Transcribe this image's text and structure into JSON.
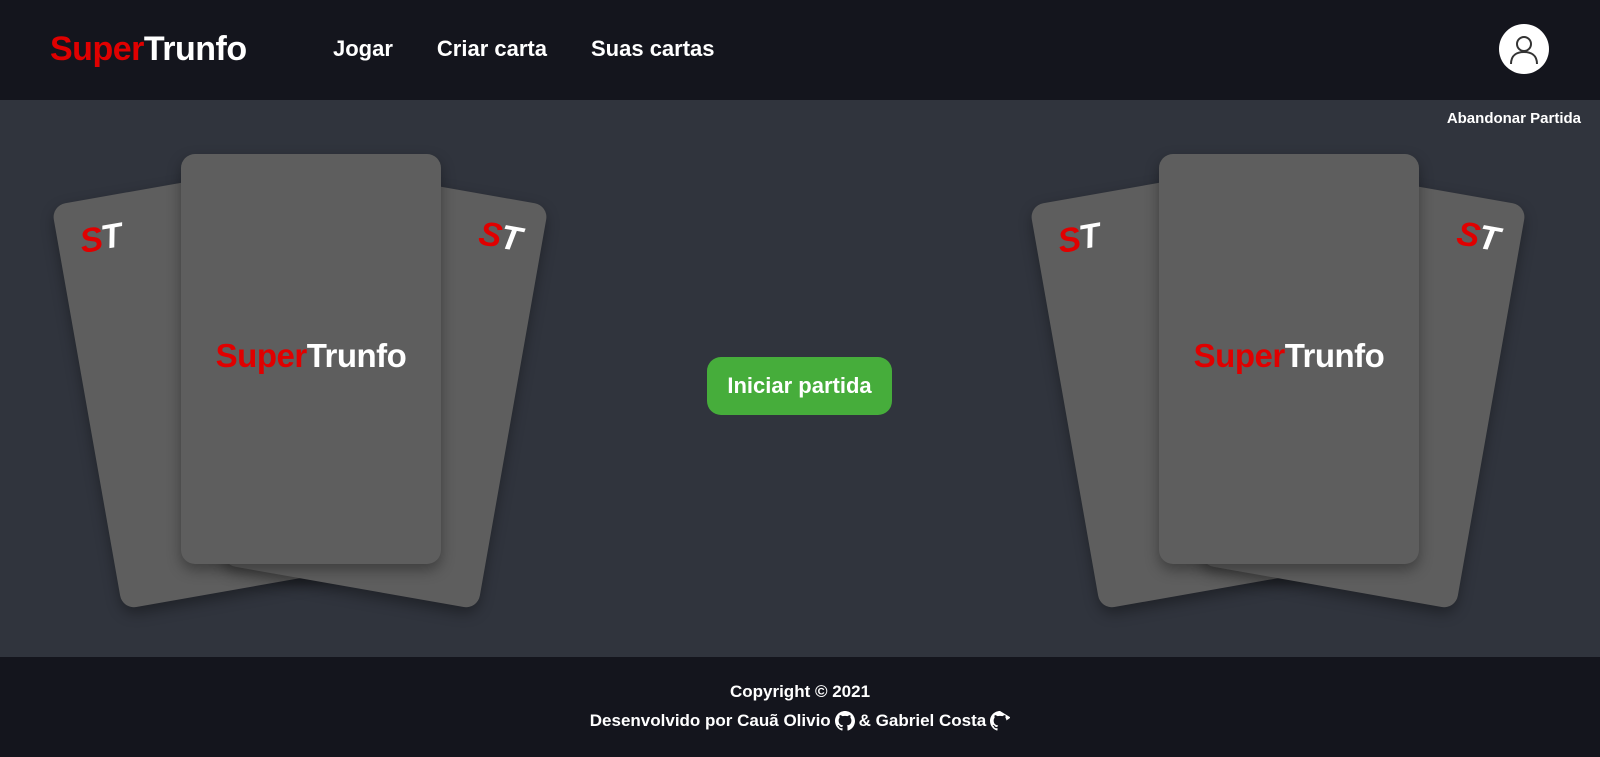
{
  "header": {
    "logo_part1": "Super",
    "logo_part2": "Trunfo",
    "nav": [
      {
        "label": "Jogar"
      },
      {
        "label": "Criar carta"
      },
      {
        "label": "Suas cartas"
      }
    ],
    "avatar_icon": "user-icon"
  },
  "main": {
    "abandon_label": "Abandonar Partida",
    "start_label": "Iniciar partida",
    "card_corner_s": "S",
    "card_corner_t": "T",
    "card_logo_part1": "Super",
    "card_logo_part2": "Trunfo"
  },
  "footer": {
    "copyright": "Copyright © 2021",
    "dev_prefix": "Desenvolvido por Cauã Olivio",
    "dev_and": "& Gabriel Costa",
    "github_icon": "github-icon"
  },
  "colors": {
    "brand_red": "#e00000",
    "header_bg": "#14151d",
    "main_bg": "#30343d",
    "card": "#5e5e5e",
    "start_button": "#46ad3b"
  }
}
